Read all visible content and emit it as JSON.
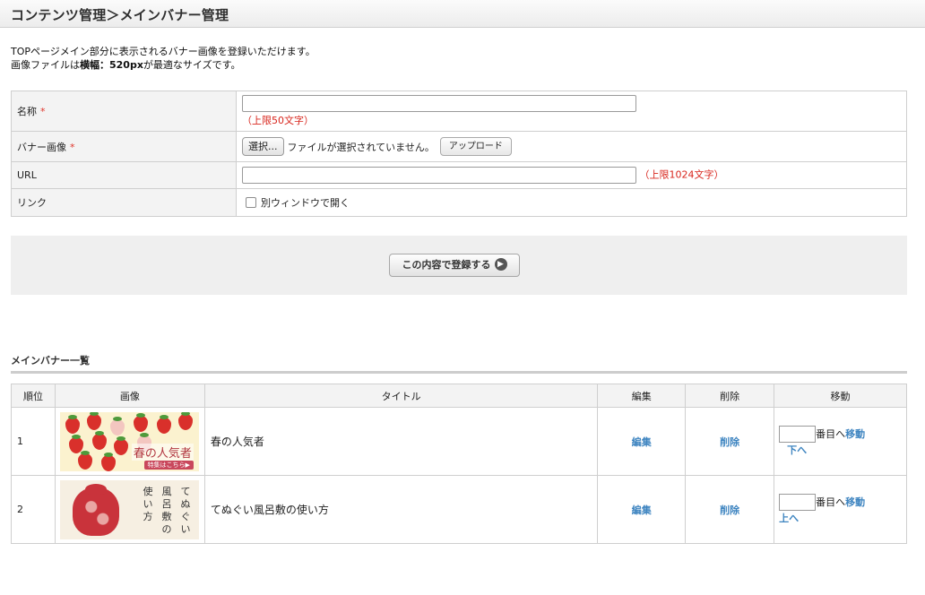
{
  "header": {
    "title": "コンテンツ管理＞メインバナー管理"
  },
  "intro": {
    "line1": "TOPページメイン部分に表示されるバナー画像を登録いただけます。",
    "line2_pre": "画像ファイルは",
    "line2_bold": "横幅：520px",
    "line2_post": "が最適なサイズです。"
  },
  "form": {
    "required_mark": "*",
    "name": {
      "label": "名称",
      "value": "",
      "limit": "（上限50文字）"
    },
    "banner": {
      "label": "バナー画像",
      "select_button": "選択...",
      "file_status": "ファイルが選択されていません。",
      "upload_button": "アップロード"
    },
    "url": {
      "label": "URL",
      "value": "",
      "limit": "（上限1024文字）"
    },
    "link": {
      "label": "リンク",
      "checkbox_label": "別ウィンドウで開く",
      "checked": false
    }
  },
  "submit_button": "この内容で登録する",
  "list": {
    "title": "メインバナー一覧",
    "columns": [
      "順位",
      "画像",
      "タイトル",
      "編集",
      "削除",
      "移動"
    ],
    "rows": [
      {
        "rank": "1",
        "title": "春の人気者",
        "image_caption": "春の人気者",
        "image_cta": "特集はこちら▶",
        "edit": "編集",
        "delete": "削除",
        "move_suffix": "番目へ",
        "move_link": "移動",
        "move_sub": "下へ"
      },
      {
        "rank": "2",
        "title": "てぬぐい風呂敷の使い方",
        "image_text": [
          "て",
          "ぬ",
          "ぐ",
          "い",
          "風",
          "呂",
          "敷",
          "の",
          "使",
          "い",
          "方"
        ],
        "edit": "編集",
        "delete": "削除",
        "move_suffix": "番目へ",
        "move_link": "移動",
        "move_sub": "上へ"
      }
    ]
  },
  "colors": {
    "required": "#e0342a",
    "limit_text": "#d8251c",
    "link": "#3d84c0",
    "label_bg": "#f3f3f3",
    "submit_area_bg": "#efefef"
  }
}
